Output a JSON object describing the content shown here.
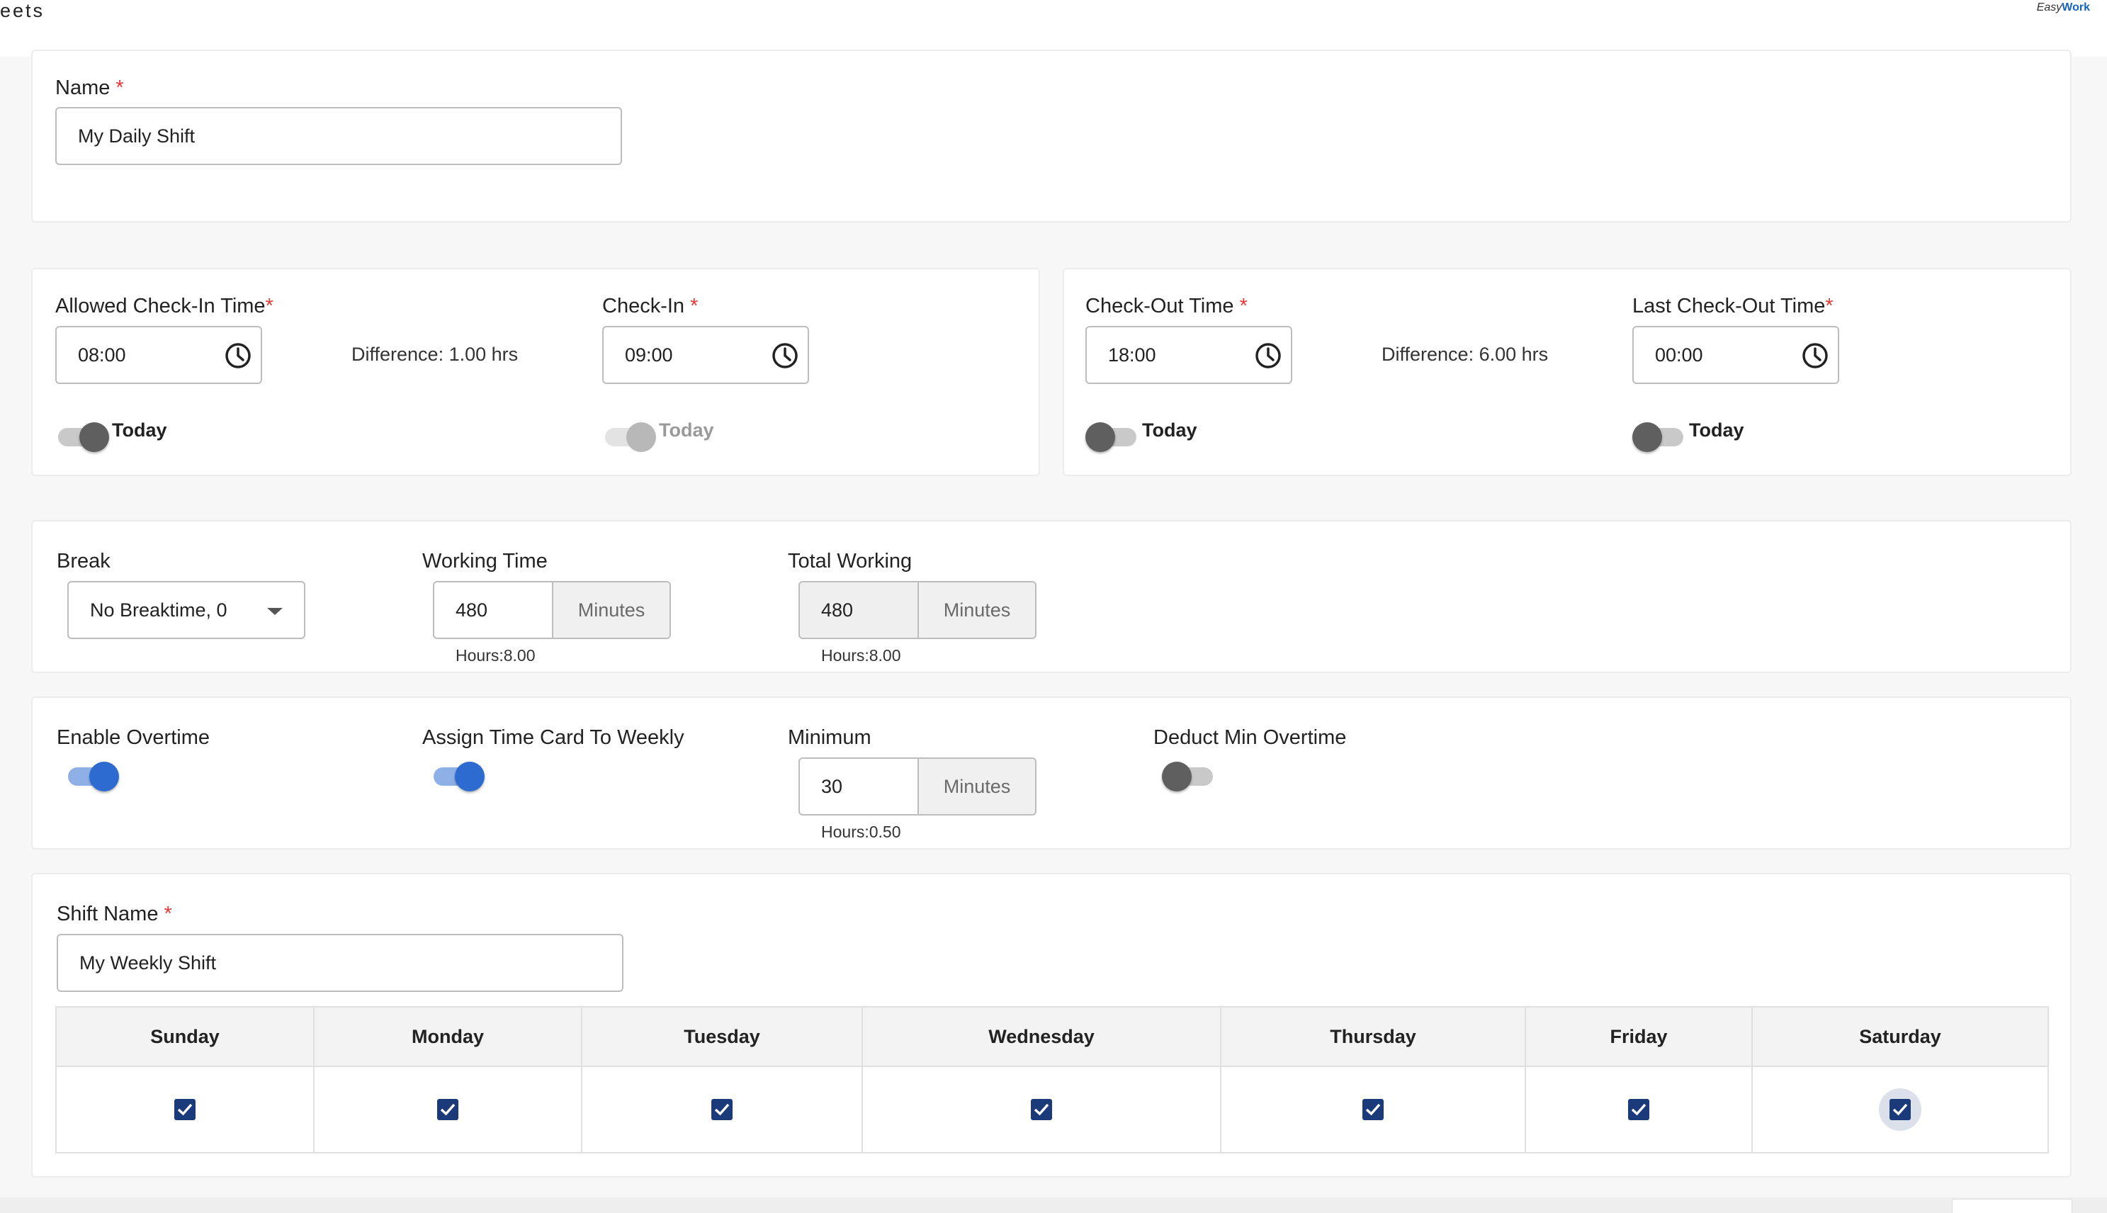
{
  "header": {
    "title": "eets",
    "logo_text_a": "Easy",
    "logo_text_b": "Work"
  },
  "name_section": {
    "label": "Name",
    "required_mark": "*",
    "value": "My Daily Shift"
  },
  "checkin": {
    "allowed_label": "Allowed Check-In Time",
    "allowed_value": "08:00",
    "difference": "Difference: 1.00 hrs",
    "checkin_label": "Check-In ",
    "checkin_value": "09:00",
    "today_label": "Today",
    "required_mark": "*"
  },
  "checkout": {
    "checkout_label": "Check-Out Time ",
    "checkout_value": "18:00",
    "difference": "Difference: 6.00 hrs",
    "last_label": "Last Check-Out Time",
    "last_value": "00:00",
    "today_label": "Today",
    "required_mark": "*"
  },
  "break_section": {
    "break_label": "Break",
    "break_value": "No Breaktime, 0",
    "working_label": "Working Time",
    "working_value": "480",
    "working_unit": "Minutes",
    "working_hint": "Hours:8.00",
    "total_label": "Total Working",
    "total_value": "480",
    "total_unit": "Minutes",
    "total_hint": "Hours:8.00"
  },
  "overtime_section": {
    "enable_label": "Enable Overtime",
    "enable_on": true,
    "assign_label": "Assign Time Card To Weekly",
    "assign_on": true,
    "minimum_label": "Minimum",
    "minimum_value": "30",
    "minimum_unit": "Minutes",
    "minimum_hint": "Hours:0.50",
    "deduct_label": "Deduct Min Overtime",
    "deduct_on": false
  },
  "weekly_section": {
    "shift_label": "Shift Name ",
    "required_mark": "*",
    "shift_value": "My Weekly Shift",
    "days": [
      "Sunday",
      "Monday",
      "Tuesday",
      "Wednesday",
      "Thursday",
      "Friday",
      "Saturday"
    ],
    "checked": [
      true,
      true,
      true,
      true,
      true,
      true,
      true
    ]
  },
  "colors": {
    "accent_blue": "#2e6bd1",
    "checkbox_navy": "#1a3a7a",
    "required_red": "#e53935"
  }
}
